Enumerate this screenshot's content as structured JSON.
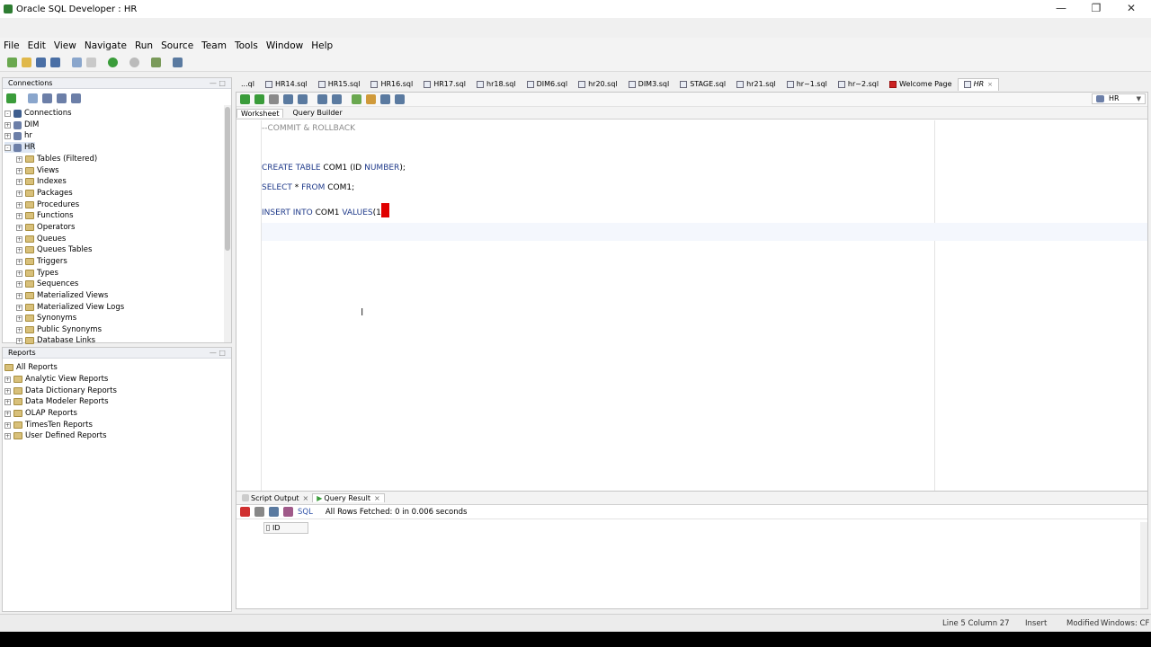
{
  "window": {
    "title": "Oracle SQL Developer : HR"
  },
  "menu": [
    "File",
    "Edit",
    "View",
    "Navigate",
    "Run",
    "Source",
    "Team",
    "Tools",
    "Window",
    "Help"
  ],
  "connections_panel": {
    "title": "Connections",
    "root": "Connections",
    "items": [
      "DIM",
      "hr",
      "HR"
    ],
    "hr_children": [
      "Tables (Filtered)",
      "Views",
      "Indexes",
      "Packages",
      "Procedures",
      "Functions",
      "Operators",
      "Queues",
      "Queues Tables",
      "Triggers",
      "Types",
      "Sequences",
      "Materialized Views",
      "Materialized View Logs",
      "Synonyms",
      "Public Synonyms",
      "Database Links"
    ]
  },
  "reports_panel": {
    "title": "Reports",
    "root": "All Reports",
    "items": [
      "Analytic View Reports",
      "Data Dictionary Reports",
      "Data Modeler Reports",
      "OLAP Reports",
      "TimesTen Reports",
      "User Defined Reports"
    ]
  },
  "file_tabs": [
    "...ql",
    "HR14.sql",
    "HR15.sql",
    "HR16.sql",
    "HR17.sql",
    "hr18.sql",
    "DIM6.sql",
    "hr20.sql",
    "DIM3.sql",
    "STAGE.sql",
    "hr21.sql",
    "hr~1.sql",
    "hr~2.sql",
    "Welcome Page",
    "HR"
  ],
  "connection_selector": "HR",
  "editor_tabs": {
    "worksheet": "Worksheet",
    "query_builder": "Query Builder"
  },
  "code": {
    "line1": "--COMMIT & ROLLBACK",
    "line3_kw1": "CREATE TABLE",
    "line3_rest": " COM1 (ID ",
    "line3_kw2": "NUMBER",
    "line3_end": ");",
    "line4_kw1": "SELECT",
    "line4_mid": " * ",
    "line4_kw2": "FROM",
    "line4_end": " COM1;",
    "line5_kw1": "INSERT INTO",
    "line5_mid": " COM1 ",
    "line5_kw2": "VALUES",
    "line5_end": "(1"
  },
  "bottom_panel": {
    "tabs": [
      "Script Output",
      "Query Result"
    ],
    "sql_label": "SQL",
    "status": "All Rows Fetched: 0 in 0.006 seconds",
    "column": "ID"
  },
  "statusbar": {
    "position": "Line 5 Column 27",
    "mode": "Insert",
    "modified": "Modified",
    "os": "Windows: CF"
  }
}
